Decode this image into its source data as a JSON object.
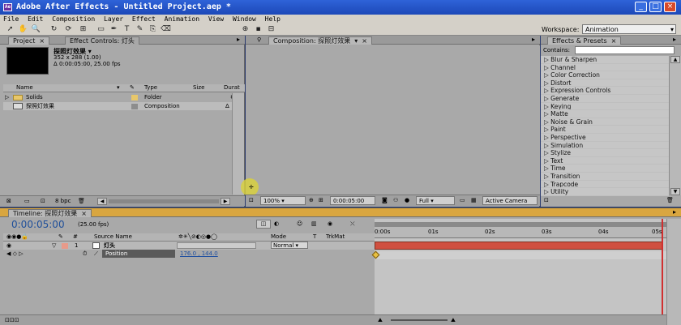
{
  "window": {
    "title": "Adobe After Effects - Untitled Project.aep *",
    "buttons": [
      "_",
      "□",
      "×"
    ]
  },
  "menu": [
    "File",
    "Edit",
    "Composition",
    "Layer",
    "Effect",
    "Animation",
    "View",
    "Window",
    "Help"
  ],
  "toolbar": {
    "workspace_label": "Workspace:",
    "workspace_value": "Animation"
  },
  "project": {
    "tab": "Project",
    "tab2": "Effect Controls: 灯头",
    "item_name": "探照灯效果 ▾",
    "item_dims": "352 x 288 (1.00)",
    "item_dur": "Δ 0:00:05:00, 25.00 fps",
    "cols": [
      "Name",
      "Type",
      "Size",
      "Durat"
    ],
    "rows": [
      {
        "name": "Solids",
        "type": "Folder",
        "dur": ""
      },
      {
        "name": "探照灯效果",
        "type": "Composition",
        "dur": "Δ"
      }
    ],
    "bpc": "8 bpc"
  },
  "comp": {
    "tab": "Composition: 探照灯效果",
    "zoom": "100%",
    "time": "0:00:05:00",
    "res": "Full",
    "view": "Active Camera"
  },
  "effects": {
    "tab": "Effects & Presets",
    "contains": "Contains:",
    "items": [
      "Blur & Sharpen",
      "Channel",
      "Color Correction",
      "Distort",
      "Expression Controls",
      "Generate",
      "Keying",
      "Matte",
      "Noise & Grain",
      "Paint",
      "Perspective",
      "Simulation",
      "Stylize",
      "Text",
      "Time",
      "Transition",
      "Trapcode",
      "Utility"
    ]
  },
  "timeline": {
    "tab": "Timeline: 探照灯效果",
    "timecode": "0:00:05:00",
    "fps": "(25.00 fps)",
    "cols": {
      "source": "Source Name",
      "mode": "Mode",
      "t": "T",
      "trk": "TrkMat"
    },
    "layer": {
      "num": "1",
      "name": "灯头",
      "mode": "Normal"
    },
    "prop": {
      "name": "Position",
      "value": "176.0 , 144.0"
    },
    "ruler": [
      "0:00s",
      "01s",
      "02s",
      "03s",
      "04s",
      "05s"
    ]
  }
}
